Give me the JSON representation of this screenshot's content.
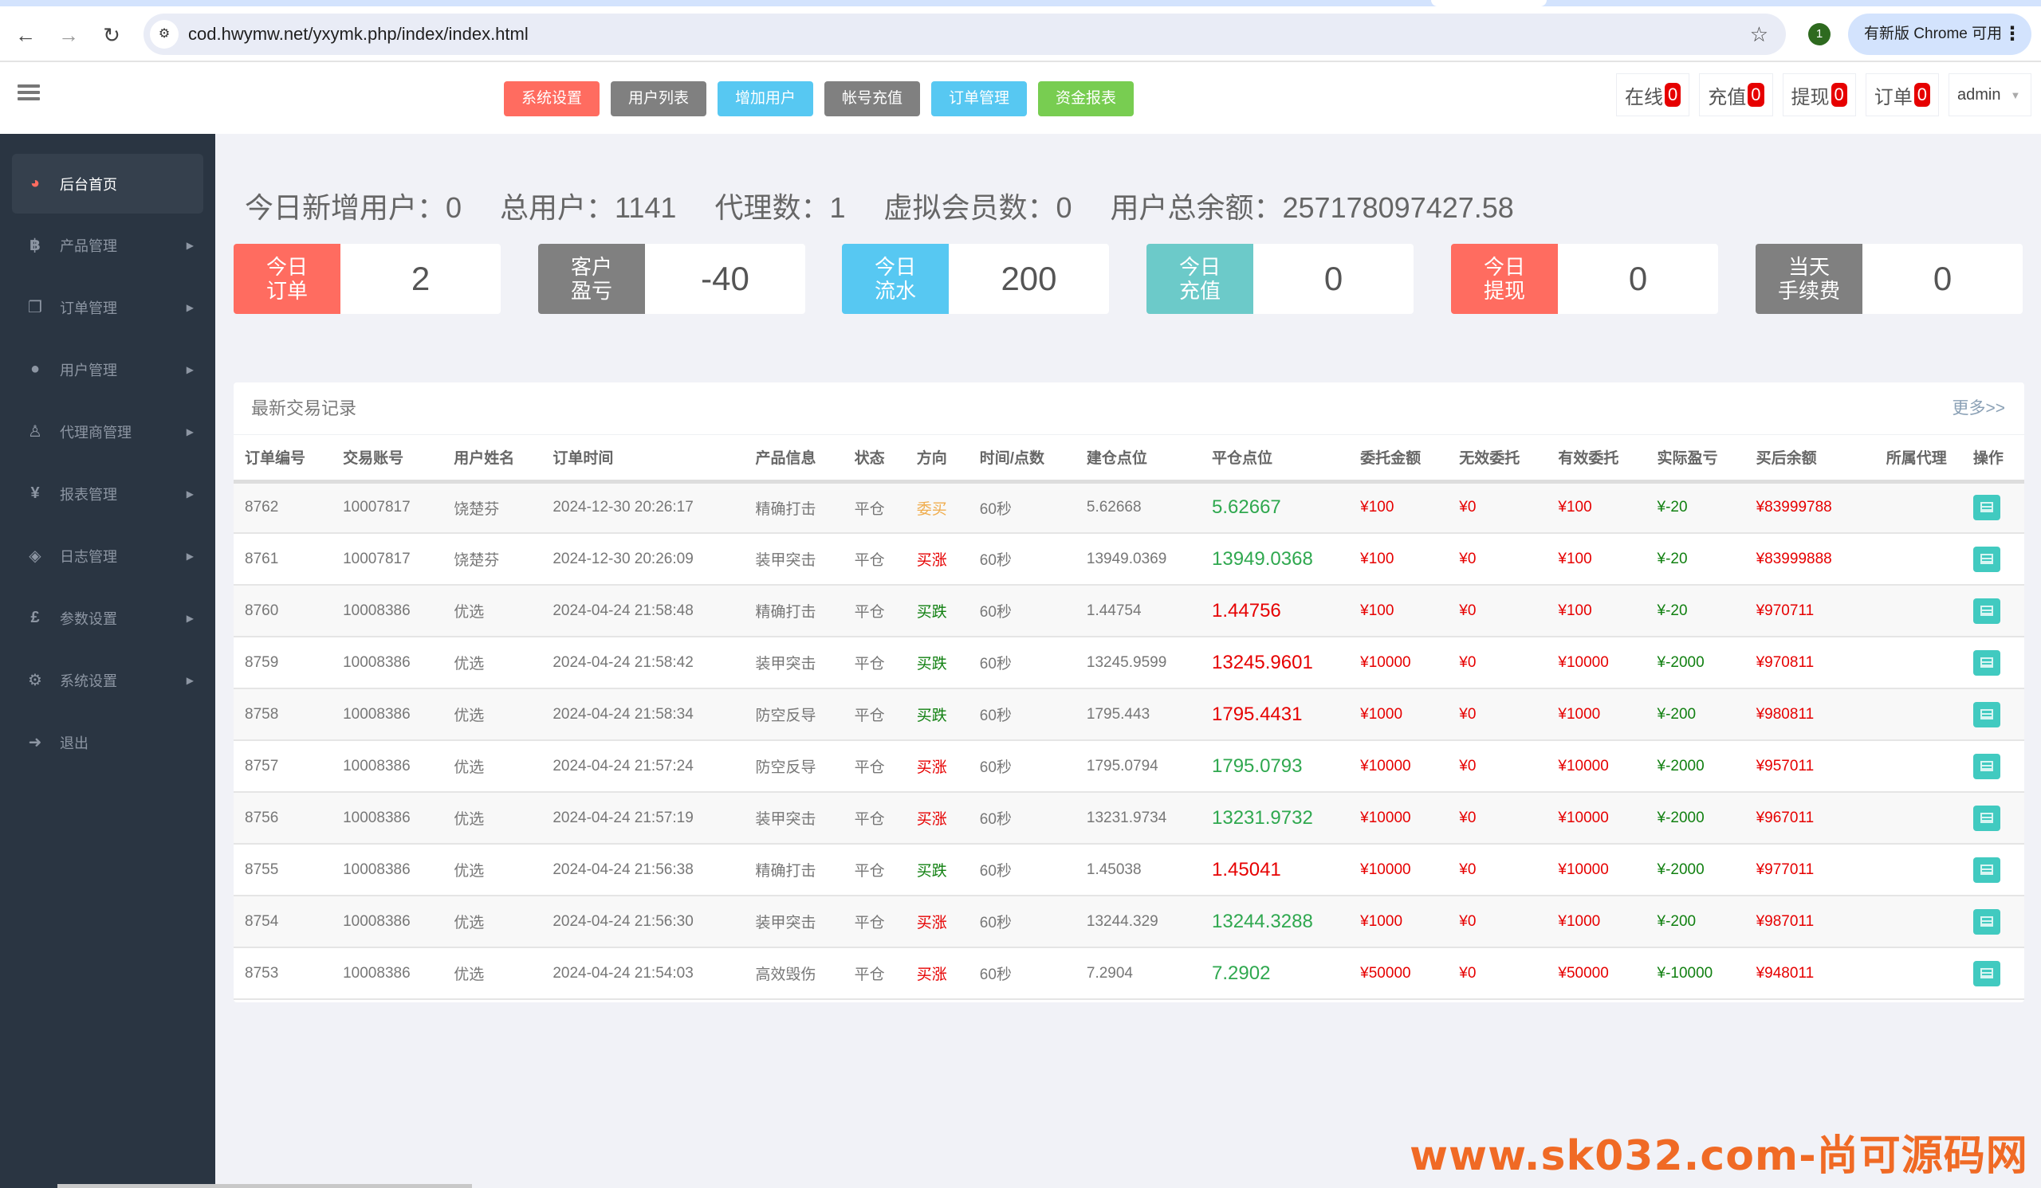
{
  "browser": {
    "url": "cod.hwymw.net/yxymk.php/index/index.html",
    "extension_badge": "1",
    "update_label": "有新版 Chrome 可用"
  },
  "header": {
    "quick_buttons": [
      {
        "label": "系统设置",
        "color": "#ff6c60"
      },
      {
        "label": "用户列表",
        "color": "#808080"
      },
      {
        "label": "增加用户",
        "color": "#57c8f2"
      },
      {
        "label": "帐号充值",
        "color": "#808080"
      },
      {
        "label": "订单管理",
        "color": "#57c8f2"
      },
      {
        "label": "资金报表",
        "color": "#78cd51"
      }
    ],
    "indicators": [
      {
        "label": "在线",
        "count": "0"
      },
      {
        "label": "充值",
        "count": "0"
      },
      {
        "label": "提现",
        "count": "0"
      },
      {
        "label": "订单",
        "count": "0"
      }
    ],
    "user": "admin"
  },
  "sidebar": {
    "items": [
      {
        "label": "后台首页",
        "icon": "dashboard-icon",
        "glyph": "◕",
        "active": true
      },
      {
        "label": "产品管理",
        "icon": "bitcoin-icon",
        "glyph": "฿"
      },
      {
        "label": "订单管理",
        "icon": "copy-icon",
        "glyph": "❐"
      },
      {
        "label": "用户管理",
        "icon": "user-icon",
        "glyph": "●"
      },
      {
        "label": "代理商管理",
        "icon": "user-md-icon",
        "glyph": "♙"
      },
      {
        "label": "报表管理",
        "icon": "yen-icon",
        "glyph": "¥"
      },
      {
        "label": "日志管理",
        "icon": "ticket-icon",
        "glyph": "◈"
      },
      {
        "label": "参数设置",
        "icon": "pound-icon",
        "glyph": "£"
      },
      {
        "label": "系统设置",
        "icon": "gears-icon",
        "glyph": "⚙"
      },
      {
        "label": "退出",
        "icon": "sign-out-icon",
        "glyph": "➜"
      }
    ]
  },
  "summary": {
    "new_users_today": "今日新增用户：0",
    "total_users": "总用户：1141",
    "agents": "代理数：1",
    "virtual_members": "虚拟会员数：0",
    "total_balance": "用户总余额：257178097427.58"
  },
  "stats": [
    {
      "label_line1": "今日",
      "label_line2": "订单",
      "value": "2",
      "color": "#ff6c60"
    },
    {
      "label_line1": "客户",
      "label_line2": "盈亏",
      "value": "-40",
      "color": "#808080"
    },
    {
      "label_line1": "今日",
      "label_line2": "流水",
      "value": "200",
      "color": "#57c8f2"
    },
    {
      "label_line1": "今日",
      "label_line2": "充值",
      "value": "0",
      "color": "#6ccac9"
    },
    {
      "label_line1": "今日",
      "label_line2": "提现",
      "value": "0",
      "color": "#ff6c60"
    },
    {
      "label_line1": "当天",
      "label_line2": "手续费",
      "value": "0",
      "color": "#808080"
    }
  ],
  "trades": {
    "title": "最新交易记录",
    "more_label": "更多>>",
    "columns": [
      "订单编号",
      "交易账号",
      "用户姓名",
      "订单时间",
      "产品信息",
      "状态",
      "方向",
      "时间/点数",
      "建仓点位",
      "平仓点位",
      "委托金额",
      "无效委托",
      "有效委托",
      "实际盈亏",
      "买后余额",
      "所属代理",
      "操作"
    ],
    "rows": [
      {
        "id": "8762",
        "account": "10007817",
        "name": "饶楚芬",
        "time": "2024-12-30 20:26:17",
        "product": "精确打击",
        "status": "平仓",
        "direction": "委买",
        "dir_color": "orange",
        "period": "60秒",
        "open": "5.62668",
        "close": "5.62667",
        "close_color": "up",
        "amount": "¥100",
        "invalid": "¥0",
        "valid": "¥100",
        "pnl": "¥-20",
        "balance": "¥83999788",
        "agent": ""
      },
      {
        "id": "8761",
        "account": "10007817",
        "name": "饶楚芬",
        "time": "2024-12-30 20:26:09",
        "product": "装甲突击",
        "status": "平仓",
        "direction": "买涨",
        "dir_color": "red",
        "period": "60秒",
        "open": "13949.0369",
        "close": "13949.0368",
        "close_color": "up",
        "amount": "¥100",
        "invalid": "¥0",
        "valid": "¥100",
        "pnl": "¥-20",
        "balance": "¥83999888",
        "agent": ""
      },
      {
        "id": "8760",
        "account": "10008386",
        "name": "优选",
        "time": "2024-04-24 21:58:48",
        "product": "精确打击",
        "status": "平仓",
        "direction": "买跌",
        "dir_color": "green",
        "period": "60秒",
        "open": "1.44754",
        "close": "1.44756",
        "close_color": "down",
        "amount": "¥100",
        "invalid": "¥0",
        "valid": "¥100",
        "pnl": "¥-20",
        "balance": "¥970711",
        "agent": ""
      },
      {
        "id": "8759",
        "account": "10008386",
        "name": "优选",
        "time": "2024-04-24 21:58:42",
        "product": "装甲突击",
        "status": "平仓",
        "direction": "买跌",
        "dir_color": "green",
        "period": "60秒",
        "open": "13245.9599",
        "close": "13245.9601",
        "close_color": "down",
        "amount": "¥10000",
        "invalid": "¥0",
        "valid": "¥10000",
        "pnl": "¥-2000",
        "balance": "¥970811",
        "agent": ""
      },
      {
        "id": "8758",
        "account": "10008386",
        "name": "优选",
        "time": "2024-04-24 21:58:34",
        "product": "防空反导",
        "status": "平仓",
        "direction": "买跌",
        "dir_color": "green",
        "period": "60秒",
        "open": "1795.443",
        "close": "1795.4431",
        "close_color": "down",
        "amount": "¥1000",
        "invalid": "¥0",
        "valid": "¥1000",
        "pnl": "¥-200",
        "balance": "¥980811",
        "agent": ""
      },
      {
        "id": "8757",
        "account": "10008386",
        "name": "优选",
        "time": "2024-04-24 21:57:24",
        "product": "防空反导",
        "status": "平仓",
        "direction": "买涨",
        "dir_color": "red",
        "period": "60秒",
        "open": "1795.0794",
        "close": "1795.0793",
        "close_color": "up",
        "amount": "¥10000",
        "invalid": "¥0",
        "valid": "¥10000",
        "pnl": "¥-2000",
        "balance": "¥957011",
        "agent": ""
      },
      {
        "id": "8756",
        "account": "10008386",
        "name": "优选",
        "time": "2024-04-24 21:57:19",
        "product": "装甲突击",
        "status": "平仓",
        "direction": "买涨",
        "dir_color": "red",
        "period": "60秒",
        "open": "13231.9734",
        "close": "13231.9732",
        "close_color": "up",
        "amount": "¥10000",
        "invalid": "¥0",
        "valid": "¥10000",
        "pnl": "¥-2000",
        "balance": "¥967011",
        "agent": ""
      },
      {
        "id": "8755",
        "account": "10008386",
        "name": "优选",
        "time": "2024-04-24 21:56:38",
        "product": "精确打击",
        "status": "平仓",
        "direction": "买跌",
        "dir_color": "green",
        "period": "60秒",
        "open": "1.45038",
        "close": "1.45041",
        "close_color": "down",
        "amount": "¥10000",
        "invalid": "¥0",
        "valid": "¥10000",
        "pnl": "¥-2000",
        "balance": "¥977011",
        "agent": ""
      },
      {
        "id": "8754",
        "account": "10008386",
        "name": "优选",
        "time": "2024-04-24 21:56:30",
        "product": "装甲突击",
        "status": "平仓",
        "direction": "买涨",
        "dir_color": "red",
        "period": "60秒",
        "open": "13244.329",
        "close": "13244.3288",
        "close_color": "up",
        "amount": "¥1000",
        "invalid": "¥0",
        "valid": "¥1000",
        "pnl": "¥-200",
        "balance": "¥987011",
        "agent": ""
      },
      {
        "id": "8753",
        "account": "10008386",
        "name": "优选",
        "time": "2024-04-24 21:54:03",
        "product": "高效毁伤",
        "status": "平仓",
        "direction": "买涨",
        "dir_color": "red",
        "period": "60秒",
        "open": "7.2904",
        "close": "7.2902",
        "close_color": "up",
        "amount": "¥50000",
        "invalid": "¥0",
        "valid": "¥50000",
        "pnl": "¥-10000",
        "balance": "¥948011",
        "agent": ""
      }
    ]
  },
  "watermark": "www.sk032.com-尚可源码网"
}
